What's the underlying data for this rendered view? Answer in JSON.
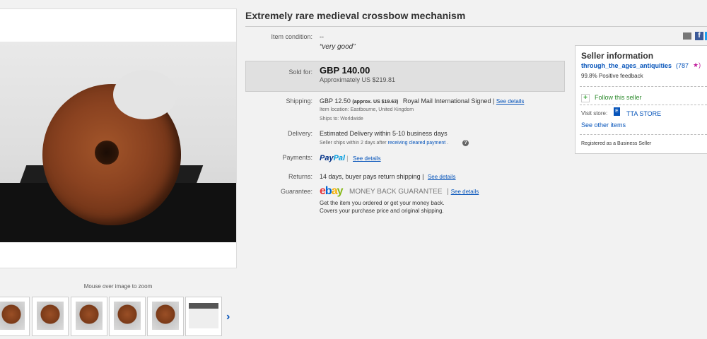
{
  "listing": {
    "title": "Extremely rare medieval crossbow mechanism"
  },
  "gallery": {
    "zoom_note": "Mouse over image to zoom",
    "next_icon": "›",
    "thumbnail_count": 6
  },
  "details": {
    "condition_label": "Item condition:",
    "condition_value": "--",
    "condition_quote": "“very good”",
    "sold_label": "Sold for:",
    "sold_price": "GBP 140.00",
    "sold_approx": "Approximately US $219.81",
    "shipping_label": "Shipping:",
    "shipping_cost": "GBP 12.50",
    "shipping_approx": "(approx. US $19.63)",
    "shipping_service": "Royal Mail International Signed |",
    "shipping_see_details": "See details",
    "item_location_label": "Item location:",
    "item_location": "Eastbourne, United Kingdom",
    "ships_to_label": "Ships to:",
    "ships_to": "Worldwide",
    "delivery_label": "Delivery:",
    "delivery_value": "Estimated Delivery within 5-10 business days",
    "delivery_note": "Seller ships within 2 days after",
    "delivery_link": "receiving cleared payment",
    "delivery_dot": ".",
    "help_icon": "?",
    "payments_label": "Payments:",
    "paypal_a": "Pay",
    "paypal_b": "Pal",
    "payments_see_details": "See details",
    "returns_label": "Returns:",
    "returns_value": "14 days, buyer pays return shipping |",
    "returns_see_details": "See details",
    "guarantee_label": "Guarantee:",
    "ebay_e": "e",
    "ebay_b": "b",
    "ebay_a": "a",
    "ebay_y": "y",
    "guarantee_text": "MONEY BACK GUARANTEE",
    "guarantee_sep": "|",
    "guarantee_see_details": "See details",
    "guarantee_line1": "Get the item you ordered or get your money back.",
    "guarantee_line2": "Covers your purchase price and original shipping."
  },
  "seller": {
    "title": "Seller information",
    "name": "through_the_ages_antiquities",
    "score": "(787",
    "star": "★)",
    "feedback": "99.8% Positive feedback",
    "follow": "Follow this seller",
    "follow_icon": "+",
    "visit_label": "Visit store:",
    "store_icon": "E",
    "store_name": "TTA STORE",
    "other_items": "See other items",
    "registered": "Registered as a Business Seller"
  },
  "share": {
    "facebook_glyph": "f"
  },
  "colors": {
    "link": "#0654ba",
    "follow": "#2e8b2e",
    "ebay_red": "#e53238",
    "ebay_blue": "#0064d2",
    "ebay_yellow": "#f5af02",
    "ebay_green": "#86b817"
  }
}
